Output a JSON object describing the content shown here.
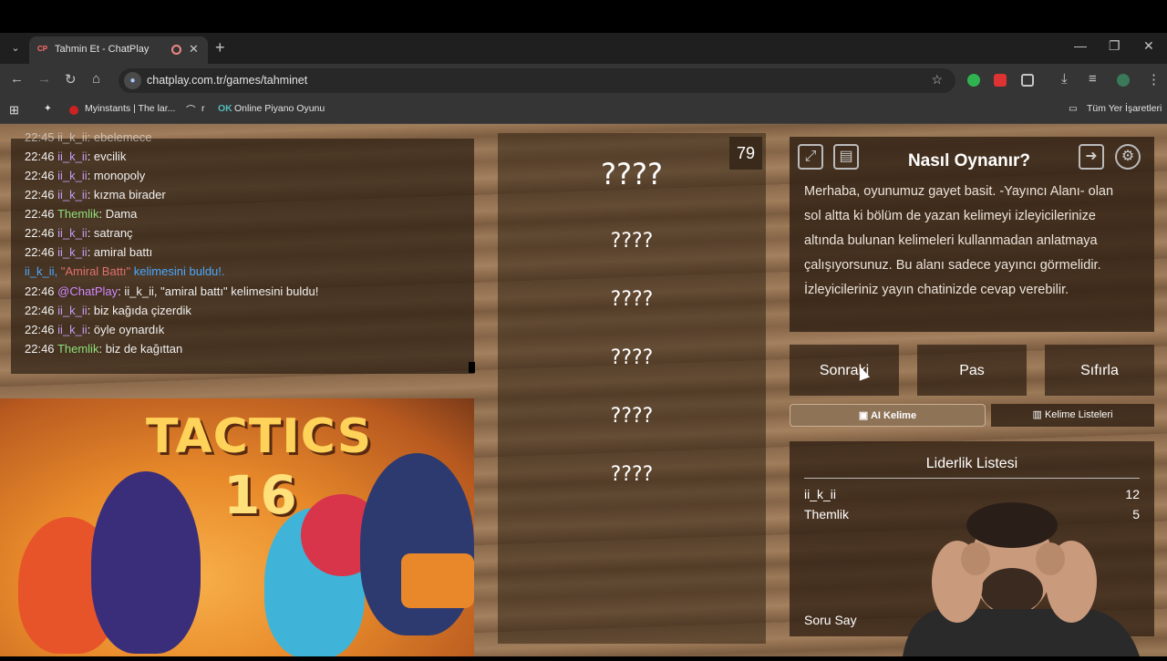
{
  "browser": {
    "tab_title": "Tahmin Et - ChatPlay",
    "tab_favicon": "CP",
    "url": "chatplay.com.tr/games/tahminet",
    "bookmarks": [
      {
        "label": "Myinstants | The lar..."
      },
      {
        "label": "r"
      },
      {
        "label": "Online Piyano Oyunu"
      }
    ],
    "all_bookmarks": "Tüm Yer İşaretleri"
  },
  "chat": {
    "lines": [
      {
        "time": "22:46",
        "user": "ii_k_ii",
        "msg": "evcilik"
      },
      {
        "time": "22:46",
        "user": "ii_k_ii",
        "msg": "monopoly"
      },
      {
        "time": "22:46",
        "user": "ii_k_ii",
        "msg": "kızma birader"
      },
      {
        "time": "22:46",
        "user": "Themlik",
        "msg": "Dama"
      },
      {
        "time": "22:46",
        "user": "ii_k_ii",
        "msg": "satranç"
      },
      {
        "time": "22:46",
        "user": "ii_k_ii",
        "msg": "amiral battı"
      },
      {
        "notice_user": "ii_k_ii,",
        "notice_word": "\"Amiral Battı\"",
        "notice_rest": "kelimesini buldu!."
      },
      {
        "time": "22:46",
        "user": "@ChatPlay",
        "msg": "ii_k_ii, \"amiral battı\" kelimesini buldu!"
      },
      {
        "time": "22:46",
        "user": "ii_k_ii",
        "msg": "biz kağıda çizerdik"
      },
      {
        "time": "22:46",
        "user": "ii_k_ii",
        "msg": "öyle oynardık"
      },
      {
        "time": "22:46",
        "user": "Themlik",
        "msg": "biz de kağıttan"
      }
    ],
    "top_partial": "22:45 ii_k_ii: ebelemece"
  },
  "game_art": {
    "title": "TACTICS",
    "number": "16"
  },
  "words": {
    "counter": "79",
    "main": "????",
    "taboo": [
      "????",
      "????",
      "????",
      "????",
      "????"
    ]
  },
  "how_to": {
    "title": "Nasıl Oynanır?",
    "text": "Merhaba, oyunumuz gayet basit. -Yayıncı Alanı- olan sol altta ki bölüm de yazan kelimeyi izleyicilerinize altında bulunan kelimeleri kullanmadan anlatmaya çalışıyorsunuz. Bu alanı sadece yayıncı görmelidir. İzleyicileriniz yayın chatinizde cevap verebilir."
  },
  "actions": {
    "next": "Sonraki",
    "pass": "Pas",
    "reset": "Sıfırla"
  },
  "tabs": {
    "ai_word": "AI Kelime",
    "word_lists": "Kelime Listeleri"
  },
  "leaderboard": {
    "title": "Liderlik Listesi",
    "rows": [
      {
        "name": "ii_k_ii",
        "score": "12"
      },
      {
        "name": "Themlik",
        "score": "5"
      }
    ],
    "question_count_label": "Soru Say"
  }
}
